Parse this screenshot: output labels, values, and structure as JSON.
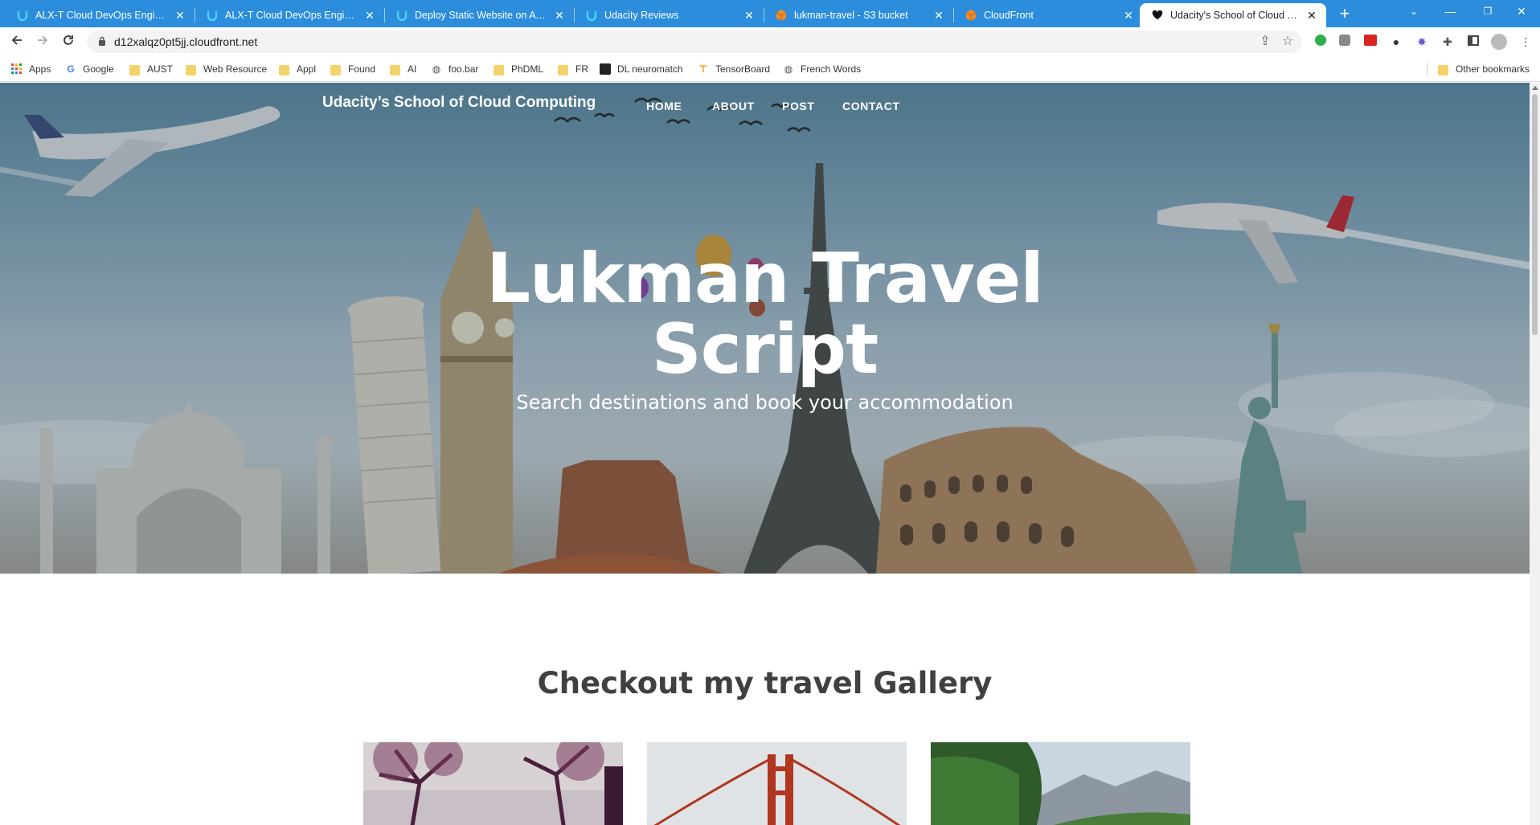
{
  "browser": {
    "tabs": [
      {
        "title": "ALX-T Cloud DevOps Engineer -",
        "favicon": "udacity-icon"
      },
      {
        "title": "ALX-T Cloud DevOps Engineer -",
        "favicon": "udacity-icon"
      },
      {
        "title": "Deploy Static Website on AWS -",
        "favicon": "udacity-icon"
      },
      {
        "title": "Udacity Reviews",
        "favicon": "udacity-icon"
      },
      {
        "title": "lukman-travel - S3 bucket",
        "favicon": "aws-cube-icon"
      },
      {
        "title": "CloudFront",
        "favicon": "aws-cube-icon"
      },
      {
        "title": "Udacity's School of Cloud Comp",
        "favicon": "heart-icon",
        "active": true
      }
    ],
    "url": "d12xalqz0pt5jj.cloudfront.net",
    "bookmarks": [
      {
        "label": "Apps",
        "icon": "apps-grid-icon"
      },
      {
        "label": "Google",
        "icon": "google-icon"
      },
      {
        "label": "AUST",
        "icon": "folder-icon"
      },
      {
        "label": "Web Resource",
        "icon": "folder-icon"
      },
      {
        "label": "Appl",
        "icon": "folder-icon"
      },
      {
        "label": "Found",
        "icon": "folder-icon"
      },
      {
        "label": "AI",
        "icon": "folder-icon"
      },
      {
        "label": "foo.bar",
        "icon": "globe-icon"
      },
      {
        "label": "PhDML",
        "icon": "folder-icon"
      },
      {
        "label": "FR",
        "icon": "folder-icon"
      },
      {
        "label": "DL neuromatch",
        "icon": "neuromatch-icon"
      },
      {
        "label": "TensorBoard",
        "icon": "tensorboard-icon"
      },
      {
        "label": "French Words",
        "icon": "globe-icon"
      }
    ],
    "other_bookmarks": "Other bookmarks",
    "colors": {
      "tabstrip": "#2b8ddc",
      "omnibox": "#f1f3f4"
    }
  },
  "site": {
    "brand": "Udacity’s School of Cloud Computing",
    "nav": [
      "HOME",
      "ABOUT",
      "POST",
      "CONTACT"
    ],
    "hero_title_line1": "Lukman Travel",
    "hero_title_line2": "Script",
    "hero_subtitle": "Search destinations and book your accommodation",
    "gallery_title": "Checkout my travel Gallery",
    "gallery_images": [
      "tree-photo",
      "golden-gate-bridge-photo",
      "mountain-forest-photo"
    ]
  }
}
